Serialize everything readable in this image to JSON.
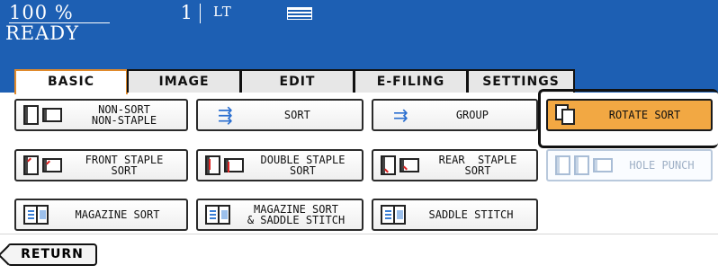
{
  "status": {
    "quantity": "100 %",
    "copies": "1",
    "paper": "LT",
    "state": "READY",
    "paper_icon": "paper-tray-icon"
  },
  "tabs": [
    {
      "label": "BASIC",
      "active": true
    },
    {
      "label": "IMAGE",
      "active": false
    },
    {
      "label": "EDIT",
      "active": false
    },
    {
      "label": "E-FILING",
      "active": false
    },
    {
      "label": "SETTINGS",
      "active": false
    }
  ],
  "finishing": {
    "row1": [
      {
        "label": "NON-SORT\nNON-STAPLE",
        "icon": "non-sort-icon"
      },
      {
        "label": "SORT",
        "icon": "sort-icon"
      },
      {
        "label": "GROUP",
        "icon": "group-icon"
      },
      {
        "label": "ROTATE SORT",
        "icon": "rotate-sort-icon",
        "selected": true
      }
    ],
    "row2": [
      {
        "label": "FRONT STAPLE\nSORT",
        "icon": "front-staple-icon"
      },
      {
        "label": "DOUBLE STAPLE\nSORT",
        "icon": "double-staple-icon"
      },
      {
        "label": "REAR  STAPLE\nSORT",
        "icon": "rear-staple-icon"
      },
      {
        "label": "HOLE PUNCH",
        "icon": "hole-punch-icon",
        "disabled": true
      }
    ],
    "row3": [
      {
        "label": "MAGAZINE SORT",
        "icon": "magazine-sort-icon"
      },
      {
        "label": "MAGAZINE SORT\n& SADDLE STITCH",
        "icon": "magazine-saddle-icon"
      },
      {
        "label": "SADDLE STITCH",
        "icon": "saddle-stitch-icon"
      }
    ]
  },
  "return_label": "RETURN",
  "colors": {
    "status_bg": "#1d5fb3",
    "selected": "#f2a843",
    "active_tab_border": "#e08a2c"
  }
}
